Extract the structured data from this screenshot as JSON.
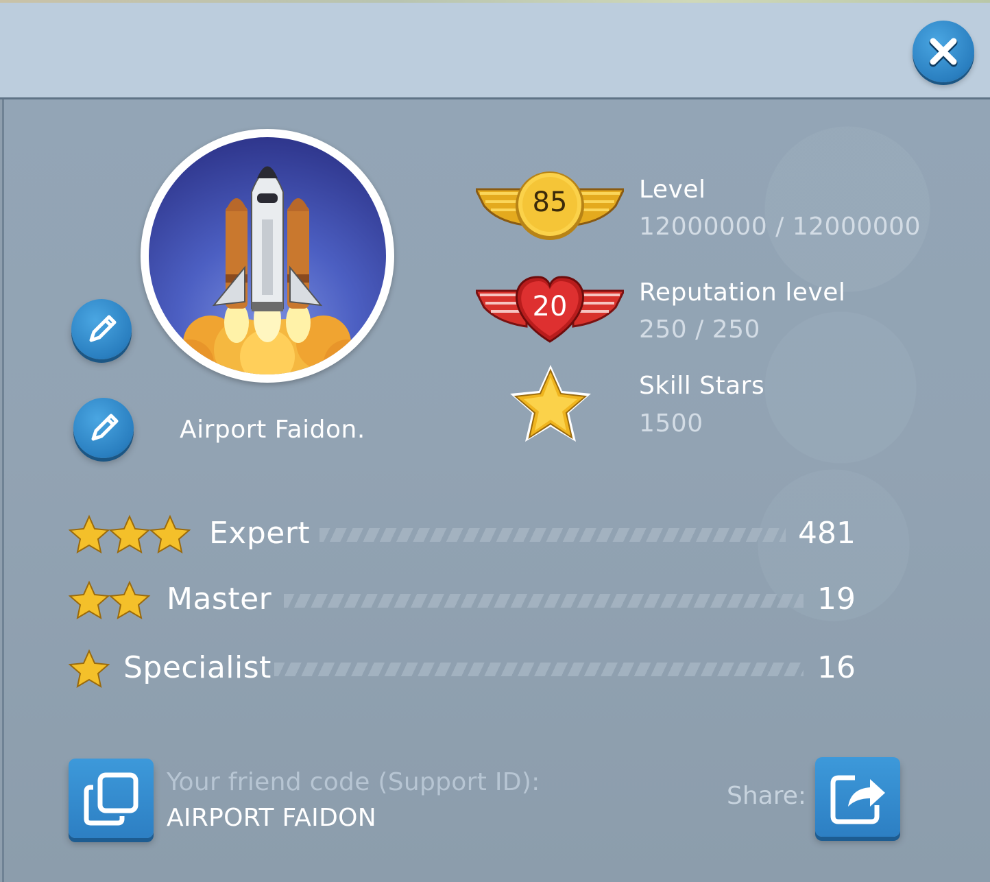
{
  "header": {
    "close_icon": "close-icon"
  },
  "profile": {
    "avatar_icon": "space-shuttle-icon",
    "edit_icon": "pencil-icon",
    "name": "Airport Faidon."
  },
  "stats": {
    "level": {
      "badge_value": "85",
      "label": "Level",
      "value": "12000000 / 12000000"
    },
    "reputation": {
      "badge_value": "20",
      "label": "Reputation level",
      "value": "250 / 250"
    },
    "skill_stars": {
      "label": "Skill Stars",
      "value": "1500"
    }
  },
  "ranks": [
    {
      "label": "Expert",
      "stars": 3,
      "count": "481"
    },
    {
      "label": "Master",
      "stars": 2,
      "count": "19"
    },
    {
      "label": "Specialist",
      "stars": 1,
      "count": "16"
    }
  ],
  "friend_code": {
    "label": "Your friend code (Support ID):",
    "value": "AIRPORT FAIDON",
    "copy_icon": "copy-icon"
  },
  "share": {
    "label": "Share:",
    "icon": "share-icon"
  },
  "colors": {
    "header_bg": "#bccddd",
    "panel_bg": "#92a3b3",
    "button_blue": "#2d7fc3",
    "gold": "#f4c430",
    "red": "#d42a2a"
  }
}
